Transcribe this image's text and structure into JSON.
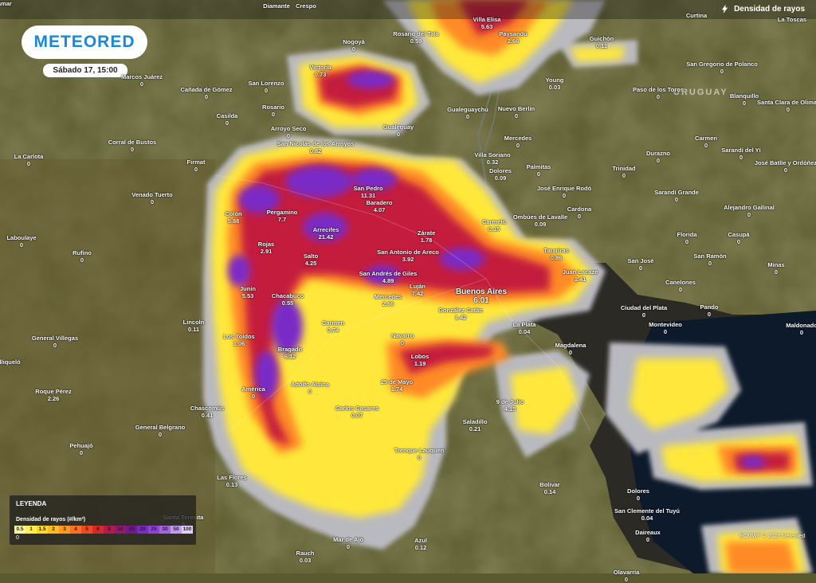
{
  "header": {
    "logo_text": "METEORED",
    "date_label": "Sábado 17, 15:00",
    "layer_name": "Densidad de rayos",
    "layer_icon": "lightning-icon"
  },
  "country_label": "URUGUAY",
  "credit": "ECMWF © 2025 Meteored",
  "legend": {
    "title": "LEYENDA",
    "subtitle": "Densidad de rayos (#/km²)",
    "zero": "0",
    "stops": [
      {
        "label": "0.5",
        "color": "#fff7a8"
      },
      {
        "label": "1",
        "color": "#ffee55"
      },
      {
        "label": "1.5",
        "color": "#ffd82a"
      },
      {
        "label": "2",
        "color": "#ffbb22"
      },
      {
        "label": "3",
        "color": "#ff9922"
      },
      {
        "label": "4",
        "color": "#ff7020"
      },
      {
        "label": "5",
        "color": "#f04a22"
      },
      {
        "label": "6",
        "color": "#d82828"
      },
      {
        "label": "8",
        "color": "#b51a48"
      },
      {
        "label": "10",
        "color": "#8e1a6a"
      },
      {
        "label": "15",
        "color": "#6f1b8a"
      },
      {
        "label": "20",
        "color": "#7a2bc0"
      },
      {
        "label": "25",
        "color": "#8e42d8"
      },
      {
        "label": "30",
        "color": "#a565e0"
      },
      {
        "label": "50",
        "color": "#c49aea"
      },
      {
        "label": "100",
        "color": "#e2cff4"
      }
    ]
  },
  "places": [
    {
      "name": "Diamante",
      "value": "",
      "big": false
    },
    {
      "name": "Crespo",
      "value": "",
      "big": false
    },
    {
      "name": "Villa Elisa",
      "value": "5.63",
      "big": false
    },
    {
      "name": "Paysandú",
      "value": "2.66",
      "big": false
    },
    {
      "name": "Curtina",
      "value": "",
      "big": false
    },
    {
      "name": "La Toscas",
      "value": "",
      "big": false
    },
    {
      "name": "Rosario del Tala",
      "value": "0.59",
      "big": false
    },
    {
      "name": "Guichón",
      "value": "0.11",
      "big": false
    },
    {
      "name": "Nogoyá",
      "value": "0",
      "big": false
    },
    {
      "name": "Victoria",
      "value": "0.73",
      "big": false
    },
    {
      "name": "San Gregorio de Polanco",
      "value": "0",
      "big": false
    },
    {
      "name": "Marcos Juárez",
      "value": "0",
      "big": false
    },
    {
      "name": "Cañada de Gómez",
      "value": "0",
      "big": false
    },
    {
      "name": "San Lorenzo",
      "value": "0",
      "big": false
    },
    {
      "name": "Young",
      "value": "0.03",
      "big": false
    },
    {
      "name": "Paso de los Toros",
      "value": "0",
      "big": false
    },
    {
      "name": "Blanquillo",
      "value": "0",
      "big": false
    },
    {
      "name": "Casilda",
      "value": "0",
      "big": false
    },
    {
      "name": "Rosario",
      "value": "0",
      "big": false
    },
    {
      "name": "Gualeguaychú",
      "value": "0",
      "big": false
    },
    {
      "name": "Nuevo Berlín",
      "value": "0",
      "big": false
    },
    {
      "name": "Santa Clara de Olimar",
      "value": "0",
      "big": false
    },
    {
      "name": "Arroyo Seco",
      "value": "0",
      "big": false
    },
    {
      "name": "Gualeguay",
      "value": "0",
      "big": false
    },
    {
      "name": "Corral de Bustos",
      "value": "0",
      "big": false
    },
    {
      "name": "San Nicolás de los Arroyos",
      "value": "0.82",
      "big": false
    },
    {
      "name": "Mercedes",
      "value": "0",
      "big": false
    },
    {
      "name": "Carmen",
      "value": "0",
      "big": false
    },
    {
      "name": "Sarandí del Yí",
      "value": "0",
      "big": false
    },
    {
      "name": "La Carlota",
      "value": "0",
      "big": false
    },
    {
      "name": "Firmat",
      "value": "0",
      "big": false
    },
    {
      "name": "Villa Soriano",
      "value": "0.32",
      "big": false
    },
    {
      "name": "Palmitas",
      "value": "0",
      "big": false
    },
    {
      "name": "Durazno",
      "value": "0",
      "big": false
    },
    {
      "name": "Dolores",
      "value": "0.09",
      "big": false
    },
    {
      "name": "Trinidad",
      "value": "0",
      "big": false
    },
    {
      "name": "José Batlle y Ordóñez",
      "value": "0",
      "big": false
    },
    {
      "name": "San Pedro",
      "value": "11.31",
      "big": false
    },
    {
      "name": "José Enrique Rodó",
      "value": "0",
      "big": false
    },
    {
      "name": "Venado Tuerto",
      "value": "0",
      "big": false
    },
    {
      "name": "Sarandí Grande",
      "value": "0",
      "big": false
    },
    {
      "name": "Baradero",
      "value": "4.07",
      "big": false
    },
    {
      "name": "Cardona",
      "value": "0",
      "big": false
    },
    {
      "name": "Alejandro Gallinal",
      "value": "0",
      "big": false
    },
    {
      "name": "Colón",
      "value": "5.88",
      "big": false
    },
    {
      "name": "Pergamino",
      "value": "7.7",
      "big": false
    },
    {
      "name": "Ombúes de Lavalle",
      "value": "0.09",
      "big": false
    },
    {
      "name": "Carmelo",
      "value": "0.15",
      "big": false
    },
    {
      "name": "Arrecifes",
      "value": "21.42",
      "big": false
    },
    {
      "name": "Laboulaye",
      "value": "0",
      "big": false
    },
    {
      "name": "Zárate",
      "value": "1.78",
      "big": false
    },
    {
      "name": "Florida",
      "value": "0",
      "big": false
    },
    {
      "name": "Casupá",
      "value": "0",
      "big": false
    },
    {
      "name": "Rojas",
      "value": "2.91",
      "big": false
    },
    {
      "name": "Rufino",
      "value": "0",
      "big": false
    },
    {
      "name": "Salto",
      "value": "4.25",
      "big": false
    },
    {
      "name": "San Antonio de Areco",
      "value": "3.92",
      "big": false
    },
    {
      "name": "Tarariras",
      "value": "0.86",
      "big": false
    },
    {
      "name": "San Ramón",
      "value": "0",
      "big": false
    },
    {
      "name": "San José",
      "value": "0",
      "big": false
    },
    {
      "name": "Minas",
      "value": "0",
      "big": false
    },
    {
      "name": "Juan Lacaze",
      "value": "1.41",
      "big": false
    },
    {
      "name": "San Andrés de Giles",
      "value": "4.89",
      "big": false
    },
    {
      "name": "Junín",
      "value": "5.53",
      "big": false
    },
    {
      "name": "Luján",
      "value": "7.42",
      "big": false
    },
    {
      "name": "Buenos Aires",
      "value": "6.01",
      "big": true
    },
    {
      "name": "Canelones",
      "value": "0",
      "big": false
    },
    {
      "name": "Chacabuco",
      "value": "0.55",
      "big": false
    },
    {
      "name": "Mercedes",
      "value": "2.66",
      "big": false
    },
    {
      "name": "Ciudad del Plata",
      "value": "0",
      "big": false
    },
    {
      "name": "Pando",
      "value": "0",
      "big": false
    },
    {
      "name": "González Catán",
      "value": "1.42",
      "big": false
    },
    {
      "name": "Lincoln",
      "value": "0.11",
      "big": false
    },
    {
      "name": "La Plata",
      "value": "0.04",
      "big": false
    },
    {
      "name": "Montevideo",
      "value": "0",
      "big": false
    },
    {
      "name": "Maldonado",
      "value": "0",
      "big": false
    },
    {
      "name": "Carmen",
      "value": "0.74",
      "big": false
    },
    {
      "name": "Navarro",
      "value": "0",
      "big": false
    },
    {
      "name": "Los Toldos",
      "value": "1.06",
      "big": false
    },
    {
      "name": "General Villegas",
      "value": "0",
      "big": false
    },
    {
      "name": "Magdalena",
      "value": "0",
      "big": false
    },
    {
      "name": "Bragado",
      "value": "6.12",
      "big": false
    },
    {
      "name": "Lobos",
      "value": "1.19",
      "big": false
    },
    {
      "name": "Salliqueló",
      "value": "",
      "big": false
    },
    {
      "name": "Adolfo Alsina",
      "value": "0",
      "big": false
    },
    {
      "name": "25 de Mayo",
      "value": "1.74",
      "big": false
    },
    {
      "name": "Roque Pérez",
      "value": "2.26",
      "big": false
    },
    {
      "name": "América",
      "value": "0",
      "big": false
    },
    {
      "name": "9 de Julio",
      "value": "4.15",
      "big": false
    },
    {
      "name": "Chascomús",
      "value": "0.41",
      "big": false
    },
    {
      "name": "Carlos Casares",
      "value": "0.07",
      "big": false
    },
    {
      "name": "Saladillo",
      "value": "0.21",
      "big": false
    },
    {
      "name": "General Belgrano",
      "value": "0",
      "big": false
    },
    {
      "name": "Pehuajó",
      "value": "0",
      "big": false
    },
    {
      "name": "Trenque Lauquen",
      "value": "0",
      "big": false
    },
    {
      "name": "Las Flores",
      "value": "0.13",
      "big": false
    },
    {
      "name": "Bolívar",
      "value": "0.14",
      "big": false
    },
    {
      "name": "Dolores",
      "value": "0",
      "big": false
    },
    {
      "name": "San Clemente del Tuyú",
      "value": "0.04",
      "big": false
    },
    {
      "name": "Santa Teresita",
      "value": "0",
      "big": false
    },
    {
      "name": "Daireaux",
      "value": "0",
      "big": false
    },
    {
      "name": "Mar de Ajó",
      "value": "0",
      "big": false
    },
    {
      "name": "Azul",
      "value": "0.12",
      "big": false
    },
    {
      "name": "Rauch",
      "value": "0.03",
      "big": false
    },
    {
      "name": "Olavarría",
      "value": "0",
      "big": false
    },
    {
      "name": "Pinamar",
      "value": "",
      "big": false
    }
  ]
}
